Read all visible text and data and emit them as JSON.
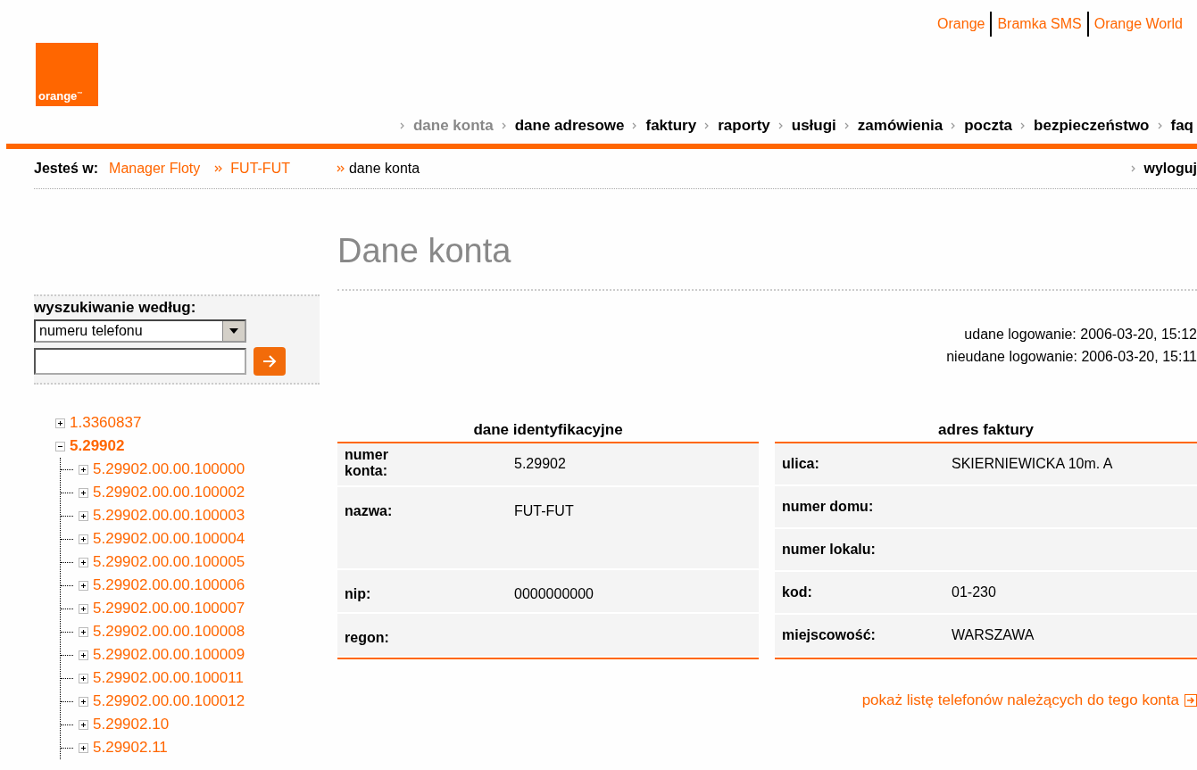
{
  "top_links": [
    "Orange",
    "Bramka SMS",
    "Orange World"
  ],
  "logo": {
    "text": "orange",
    "mark": "™"
  },
  "nav": [
    {
      "label": "dane konta",
      "selected": true
    },
    {
      "label": "dane adresowe",
      "selected": false
    },
    {
      "label": "faktury",
      "selected": false
    },
    {
      "label": "raporty",
      "selected": false
    },
    {
      "label": "usługi",
      "selected": false
    },
    {
      "label": "zamówienia",
      "selected": false
    },
    {
      "label": "poczta",
      "selected": false
    },
    {
      "label": "bezpieczeństwo",
      "selected": false
    },
    {
      "label": "faq",
      "selected": false
    }
  ],
  "breadcrumb": {
    "label": "Jesteś w:",
    "items": [
      "Manager Floty",
      "FUT-FUT"
    ],
    "current": "dane konta",
    "logout": "wyloguj"
  },
  "search": {
    "label": "wyszukiwanie według:",
    "select_value": "numeru telefonu"
  },
  "tree": [
    {
      "label": "1.3360837",
      "expanded": false
    },
    {
      "label": "5.29902",
      "expanded": true,
      "children": [
        {
          "label": "5.29902.00.00.100000",
          "expanded": false
        },
        {
          "label": "5.29902.00.00.100002",
          "expanded": false
        },
        {
          "label": "5.29902.00.00.100003",
          "expanded": false
        },
        {
          "label": "5.29902.00.00.100004",
          "expanded": false
        },
        {
          "label": "5.29902.00.00.100005",
          "expanded": false
        },
        {
          "label": "5.29902.00.00.100006",
          "expanded": false
        },
        {
          "label": "5.29902.00.00.100007",
          "expanded": false
        },
        {
          "label": "5.29902.00.00.100008",
          "expanded": false
        },
        {
          "label": "5.29902.00.00.100009",
          "expanded": false
        },
        {
          "label": "5.29902.00.00.100011",
          "expanded": false
        },
        {
          "label": "5.29902.00.00.100012",
          "expanded": false
        },
        {
          "label": "5.29902.10",
          "expanded": false
        },
        {
          "label": "5.29902.11",
          "expanded": false
        }
      ]
    }
  ],
  "page_title": "Dane konta",
  "login_info": [
    "udane logowanie: 2006-03-20, 15:12",
    "nieudane logowanie: 2006-03-20, 15:11"
  ],
  "tables": [
    {
      "title": "dane identyfikacyjne",
      "rows": [
        {
          "label": "numer konta:",
          "value": "5.29902"
        },
        {
          "label": "nazwa:",
          "value": "FUT-FUT"
        },
        {
          "label": "nip:",
          "value": "0000000000"
        },
        {
          "label": "regon:"
        }
      ]
    },
    {
      "title": "adres faktury",
      "rows": [
        {
          "label": "ulica:",
          "value": "SKIERNIEWICKA 10m. A"
        },
        {
          "label": "numer domu:"
        },
        {
          "label": "numer lokalu:"
        },
        {
          "label": "kod:",
          "value": "01-230"
        },
        {
          "label": "miejscowość:",
          "value": "WARSZAWA"
        }
      ]
    }
  ],
  "phones_link": "pokaż listę telefonów należących do tego konta"
}
